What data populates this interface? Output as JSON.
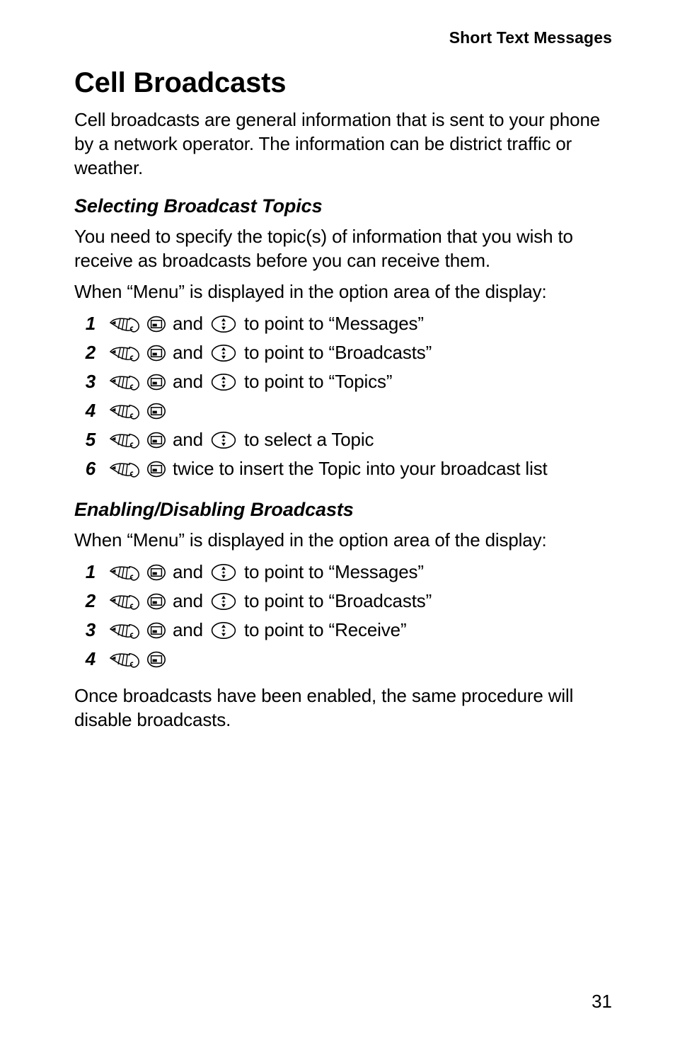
{
  "header": {
    "running_head": "Short Text Messages"
  },
  "page_title": "Cell Broadcasts",
  "intro_paragraph": "Cell broadcasts are general information that is sent to your phone by a network operator. The information can be district traffic or weather.",
  "sections": [
    {
      "heading": "Selecting Broadcast Topics",
      "intro": "You need to specify the topic(s) of information that you wish to receive as broadcasts before you can receive them.",
      "lead_in": "When “Menu” is displayed in the option area of the display:",
      "steps": [
        {
          "number": "1",
          "icons": [
            "hand-icon",
            "softkey-icon",
            "navigation-key-icon"
          ],
          "connector": "and",
          "text": "to point to “Messages”"
        },
        {
          "number": "2",
          "icons": [
            "hand-icon",
            "softkey-icon",
            "navigation-key-icon"
          ],
          "connector": "and",
          "text": "to point to “Broadcasts”"
        },
        {
          "number": "3",
          "icons": [
            "hand-icon",
            "softkey-icon",
            "navigation-key-icon"
          ],
          "connector": "and",
          "text": "to point to “Topics”"
        },
        {
          "number": "4",
          "icons": [
            "hand-icon",
            "softkey-icon"
          ],
          "connector": "",
          "text": ""
        },
        {
          "number": "5",
          "icons": [
            "hand-icon",
            "softkey-icon",
            "navigation-key-icon"
          ],
          "connector": "and",
          "text": "to select a Topic"
        },
        {
          "number": "6",
          "icons": [
            "hand-icon",
            "softkey-icon"
          ],
          "connector": "",
          "text": "twice to insert the Topic into your broadcast list"
        }
      ]
    },
    {
      "heading": "Enabling/Disabling Broadcasts",
      "intro": "",
      "lead_in": "When “Menu” is displayed in the option area of the display:",
      "steps": [
        {
          "number": "1",
          "icons": [
            "hand-icon",
            "softkey-icon",
            "navigation-key-icon"
          ],
          "connector": "and",
          "text": "to point to “Messages”"
        },
        {
          "number": "2",
          "icons": [
            "hand-icon",
            "softkey-icon",
            "navigation-key-icon"
          ],
          "connector": "and",
          "text": "to point to “Broadcasts”"
        },
        {
          "number": "3",
          "icons": [
            "hand-icon",
            "softkey-icon",
            "navigation-key-icon"
          ],
          "connector": "and",
          "text": "to point to “Receive”"
        },
        {
          "number": "4",
          "icons": [
            "hand-icon",
            "softkey-icon"
          ],
          "connector": "",
          "text": ""
        }
      ]
    }
  ],
  "closing_paragraph": "Once broadcasts have been enabled, the same procedure will disable broadcasts.",
  "page_number": "31",
  "colors": {
    "text": "#000000",
    "background": "#ffffff"
  }
}
